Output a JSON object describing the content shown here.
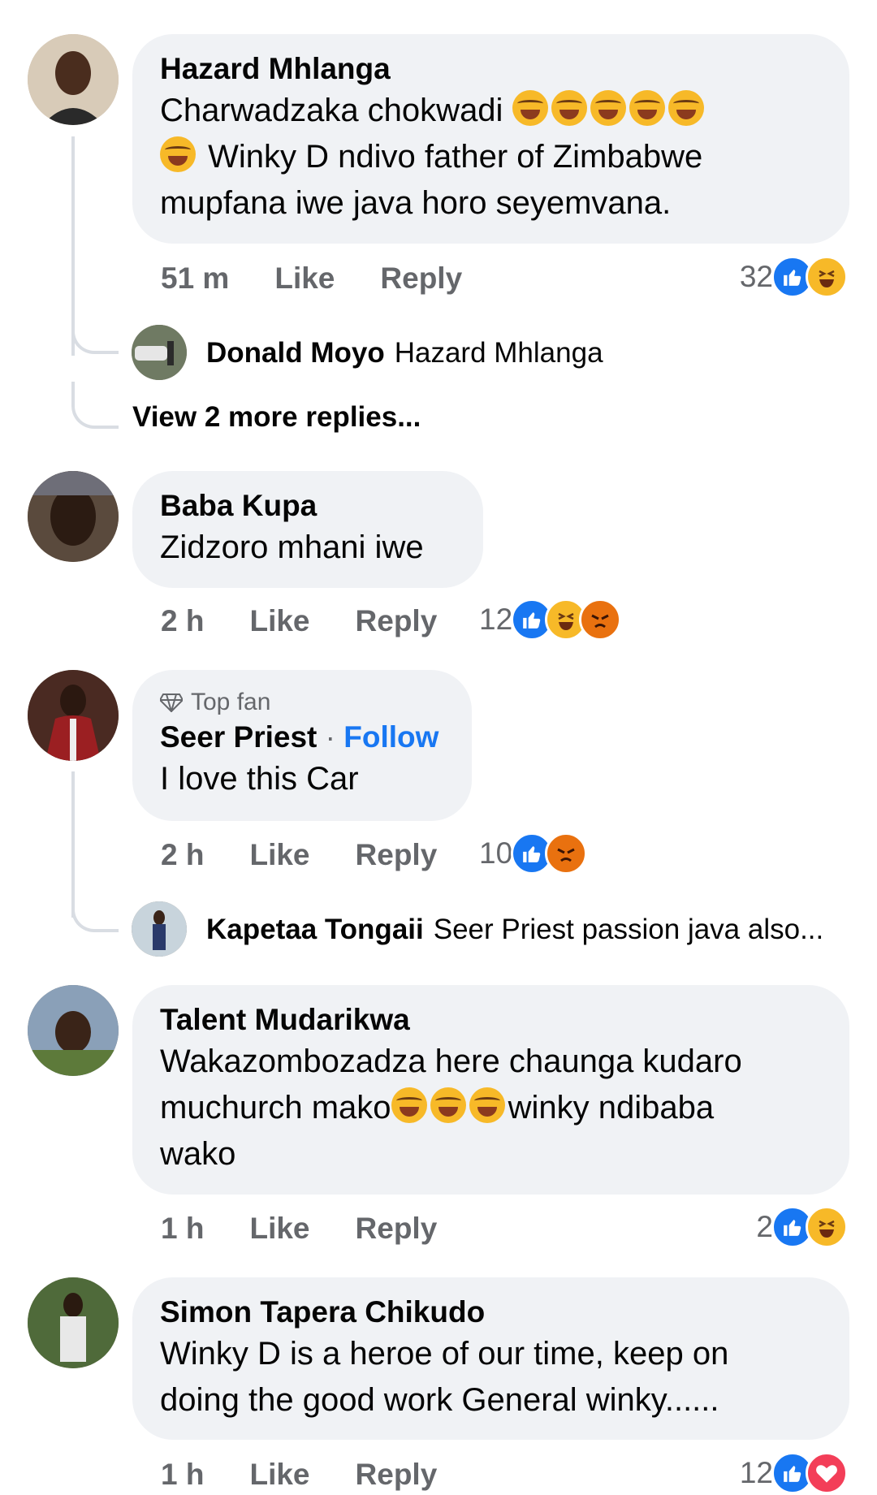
{
  "comments": [
    {
      "name": "Hazard Mhlanga",
      "text_line1": "Charwadzaka chokwadi",
      "text_line2": "Winky D ndivo father of Zimbabwe",
      "text_line3": "mupfana iwe java horo seyemvana.",
      "time": "51 m",
      "like": "Like",
      "reply": "Reply",
      "reaction_count": "32",
      "reactions": [
        "like-icon",
        "haha-icon"
      ],
      "replies": [
        {
          "name": "Donald Moyo",
          "text": "Hazard Mhlanga"
        }
      ],
      "more_replies": "View 2 more replies..."
    },
    {
      "name": "Baba Kupa",
      "text": "Zidzoro mhani iwe",
      "time": "2 h",
      "like": "Like",
      "reply": "Reply",
      "reaction_count": "12",
      "reactions": [
        "like-icon",
        "haha-icon",
        "angry-icon"
      ]
    },
    {
      "badge": "Top fan",
      "name": "Seer Priest",
      "follow": "Follow",
      "text": "I love this Car",
      "time": "2 h",
      "like": "Like",
      "reply": "Reply",
      "reaction_count": "10",
      "reactions": [
        "like-icon",
        "angry-icon"
      ],
      "replies": [
        {
          "name": "Kapetaa Tongaii",
          "text": "Seer Priest passion java also..."
        }
      ]
    },
    {
      "name": "Talent Mudarikwa",
      "text_line1": "Wakazombozadza here chaunga kudaro",
      "text_line2a": "muchurch mako",
      "text_line2b": "winky ndibaba",
      "text_line3": "wako",
      "time": "1 h",
      "like": "Like",
      "reply": "Reply",
      "reaction_count": "2",
      "reactions": [
        "like-icon",
        "haha-icon"
      ]
    },
    {
      "name": "Simon Tapera Chikudo",
      "text_line1": "Winky D is a heroe of our time, keep on",
      "text_line2": "doing the good work  General winky......",
      "time": "1 h",
      "like": "Like",
      "reply": "Reply",
      "reaction_count": "12",
      "reactions": [
        "like-icon",
        "love-icon"
      ]
    }
  ],
  "colors": {
    "bubble": "#f0f2f5",
    "meta_text": "#65676b",
    "like_blue": "#1877f2",
    "haha_yellow": "#f7b928",
    "angry_orange": "#e9710f",
    "love_red": "#f33e58"
  }
}
